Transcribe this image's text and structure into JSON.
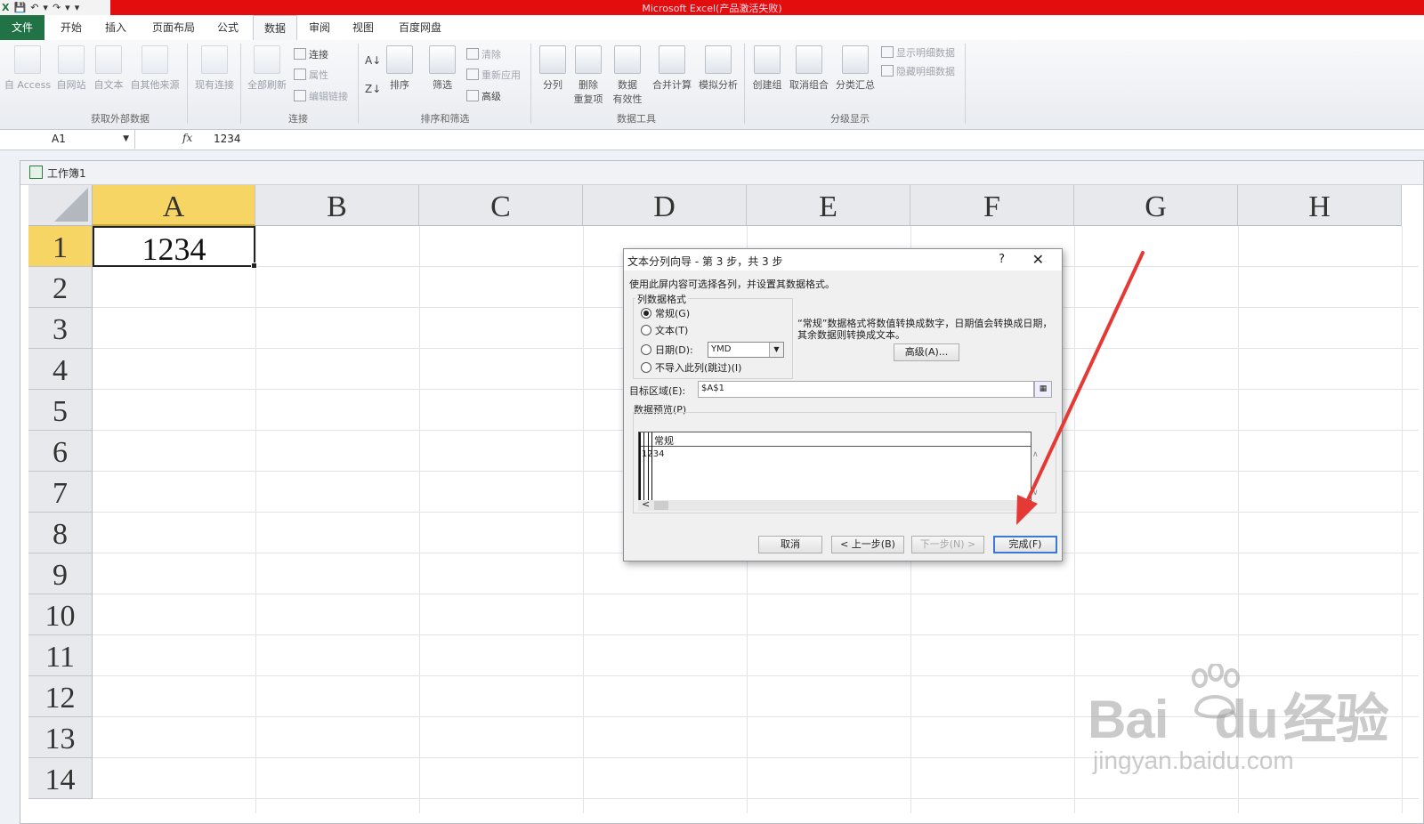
{
  "window": {
    "title": "Microsoft Excel(产品激活失败)"
  },
  "quick_access": {
    "items": [
      "X",
      "💾",
      "↶",
      "▾",
      "↷",
      "▾",
      "▾"
    ]
  },
  "menu_tabs": [
    "文件",
    "开始",
    "插入",
    "页面布局",
    "公式",
    "数据",
    "审阅",
    "视图",
    "百度网盘"
  ],
  "active_tab": "数据",
  "ribbon": {
    "get_external": {
      "label": "获取外部数据",
      "buttons": [
        "自 Access",
        "自网站",
        "自文本",
        "自其他来源",
        "现有连接"
      ]
    },
    "connections": {
      "label": "连接",
      "refresh": "全部刷新",
      "items": [
        "连接",
        "属性",
        "编辑链接"
      ]
    },
    "sort_filter": {
      "label": "排序和筛选",
      "sort": "排序",
      "filter": "筛选",
      "items": [
        "清除",
        "重新应用",
        "高级"
      ],
      "sort_asc": "A↓",
      "sort_desc": "Z↓"
    },
    "data_tools": {
      "label": "数据工具",
      "buttons": [
        "分列",
        "删除\n重复项",
        "数据\n有效性",
        "合并计算",
        "模拟分析"
      ]
    },
    "outline": {
      "label": "分级显示",
      "buttons": [
        "创建组",
        "取消组合",
        "分类汇总"
      ],
      "items": [
        "显示明细数据",
        "隐藏明细数据"
      ]
    }
  },
  "formula_bar": {
    "name_box": "A1",
    "fx": "fx",
    "value": "1234"
  },
  "workbook": {
    "title": "工作簿1"
  },
  "sheet": {
    "columns": [
      "A",
      "B",
      "C",
      "D",
      "E",
      "F",
      "G",
      "H"
    ],
    "rows": [
      "1",
      "2",
      "3",
      "4",
      "5",
      "6",
      "7",
      "8",
      "9",
      "10",
      "11",
      "12",
      "13",
      "14"
    ],
    "cell_a1": "1234",
    "selected_cell": "A1"
  },
  "dialog": {
    "title": "文本分列向导 - 第 3 步，共 3 步",
    "help": "?",
    "close": "✕",
    "instruction": "使用此屏内容可选择各列，并设置其数据格式。",
    "column_format_label": "列数据格式",
    "options": [
      "常规(G)",
      "文本(T)",
      "日期(D):",
      "不导入此列(跳过)(I)"
    ],
    "selected_option": "常规(G)",
    "date_format": "YMD",
    "description": "“常规”数据格式将数值转换成数字，日期值会转换成日期，其余数据则转换成文本。",
    "advanced": "高级(A)...",
    "destination_label": "目标区域(E):",
    "destination": "$A$1",
    "preview_label": "数据预览(P)",
    "preview_header": "常规",
    "preview_value": "1234",
    "scroll_left": "<",
    "buttons": {
      "cancel": "取消",
      "back": "< 上一步(B)",
      "next": "下一步(N) >",
      "finish": "完成(F)"
    }
  },
  "annotation": {
    "arrow_color": "#e53935"
  },
  "watermark": {
    "main": "Bai",
    "main2": "du",
    "brand": "经验",
    "sub": "jingyan.baidu.com"
  }
}
